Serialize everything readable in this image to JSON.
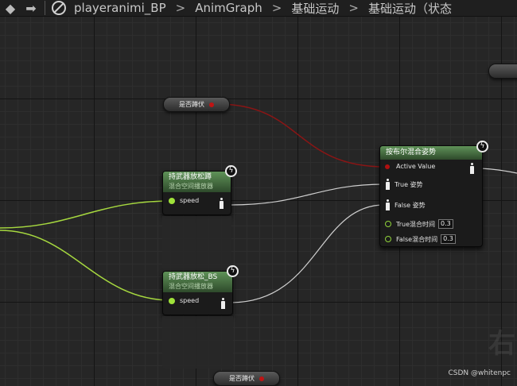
{
  "breadcrumb": {
    "back": "◆",
    "forward": "➡",
    "items": [
      "playeranimi_BP",
      "AnimGraph",
      "基础运动",
      "基础运动（状态"
    ],
    "separator": ">"
  },
  "variables": {
    "top": "是否蹲伏",
    "bottom": "是否蹲伏"
  },
  "nodes": {
    "bool_blend": {
      "title": "按布尔混合姿势",
      "pins": {
        "active_value": "Active Value",
        "true_pose": "True 姿势",
        "false_pose": "False 姿势",
        "true_blend_time": "True混合时间",
        "true_blend_value": "0.3",
        "false_blend_time": "False混合时间",
        "false_blend_value": "0.3"
      }
    },
    "blendspace_1": {
      "title": "持武器放松蹲",
      "subtitle": "混合空间播放器",
      "pin": "speed"
    },
    "blendspace_2": {
      "title": "持武器放松_BS",
      "subtitle": "混合空间播放器",
      "pin": "speed"
    }
  },
  "watermark": "CSDN @whitenpc",
  "colors": {
    "exec_wire_bool": "#8a1515",
    "float_wire": "#a6d83f",
    "pose_wire": "#cfcfcf",
    "node_header": "#4a7a44"
  }
}
